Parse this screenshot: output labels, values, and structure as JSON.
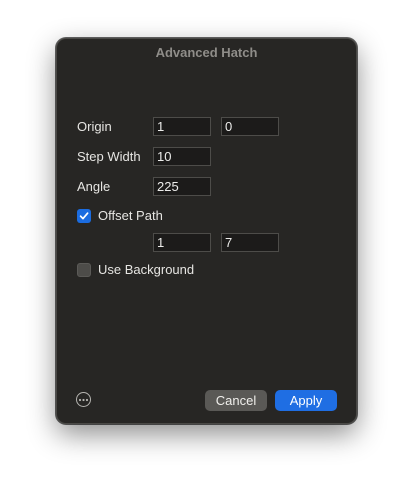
{
  "dialog": {
    "title": "Advanced Hatch",
    "origin": {
      "label": "Origin",
      "x": "1",
      "y": "0"
    },
    "step_width": {
      "label": "Step Width",
      "value": "10"
    },
    "angle": {
      "label": "Angle",
      "value": "225"
    },
    "offset_path": {
      "label": "Offset Path",
      "checked": true,
      "x": "1",
      "y": "7"
    },
    "use_background": {
      "label": "Use Background",
      "checked": false
    },
    "buttons": {
      "cancel": "Cancel",
      "apply": "Apply"
    },
    "icons": {
      "more": "ellipsis-circle-icon",
      "check": "checkmark-icon"
    },
    "colors": {
      "accent": "#1f6ee3",
      "background": "#272624"
    }
  }
}
